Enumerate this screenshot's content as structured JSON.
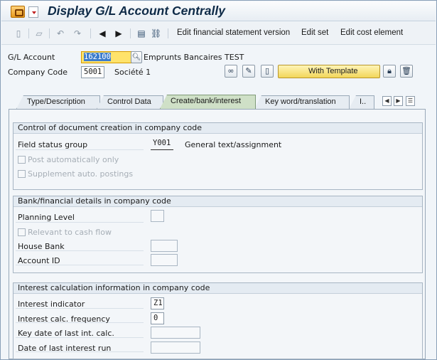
{
  "window": {
    "title": "Display G/L Account Centrally"
  },
  "toolbar": {
    "icons": [
      "new-icon",
      "copy-icon",
      "undo-icon",
      "redo-icon",
      "previous-icon",
      "next-icon",
      "print-icon",
      "link-icon"
    ],
    "edit_fs_version": "Edit financial statement version",
    "edit_set": "Edit set",
    "edit_cost_element": "Edit cost element"
  },
  "header": {
    "gl_account_label": "G/L Account",
    "gl_account_value": "162100",
    "gl_account_desc": "Emprunts Bancaires TEST",
    "company_code_label": "Company Code",
    "company_code_value": "5001",
    "company_code_desc": "Société 1",
    "with_template": "With Template"
  },
  "tabs": [
    {
      "label": "Type/Description",
      "active": false
    },
    {
      "label": "Control Data",
      "active": false
    },
    {
      "label": "Create/bank/interest",
      "active": true
    },
    {
      "label": "Key word/translation",
      "active": false
    },
    {
      "label": "I..",
      "active": false
    }
  ],
  "doc_creation": {
    "title": "Control of document creation in company code",
    "field_status_group_label": "Field status group",
    "field_status_group_value": "Y001",
    "field_status_group_desc": "General text/assignment",
    "post_auto_only": "Post automatically only",
    "supplement_auto": "Supplement auto. postings"
  },
  "bank": {
    "title": "Bank/financial details in company code",
    "planning_level": "Planning Level",
    "relevant_cash_flow": "Relevant to cash flow",
    "house_bank": "House Bank",
    "account_id": "Account ID"
  },
  "interest": {
    "title": "Interest calculation information in company code",
    "indicator_label": "Interest indicator",
    "indicator_value": "Z1",
    "frequency_label": "Interest calc. frequency",
    "frequency_value": "0",
    "key_date_label": "Key date of last int. calc.",
    "last_run_label": "Date of last interest run"
  }
}
